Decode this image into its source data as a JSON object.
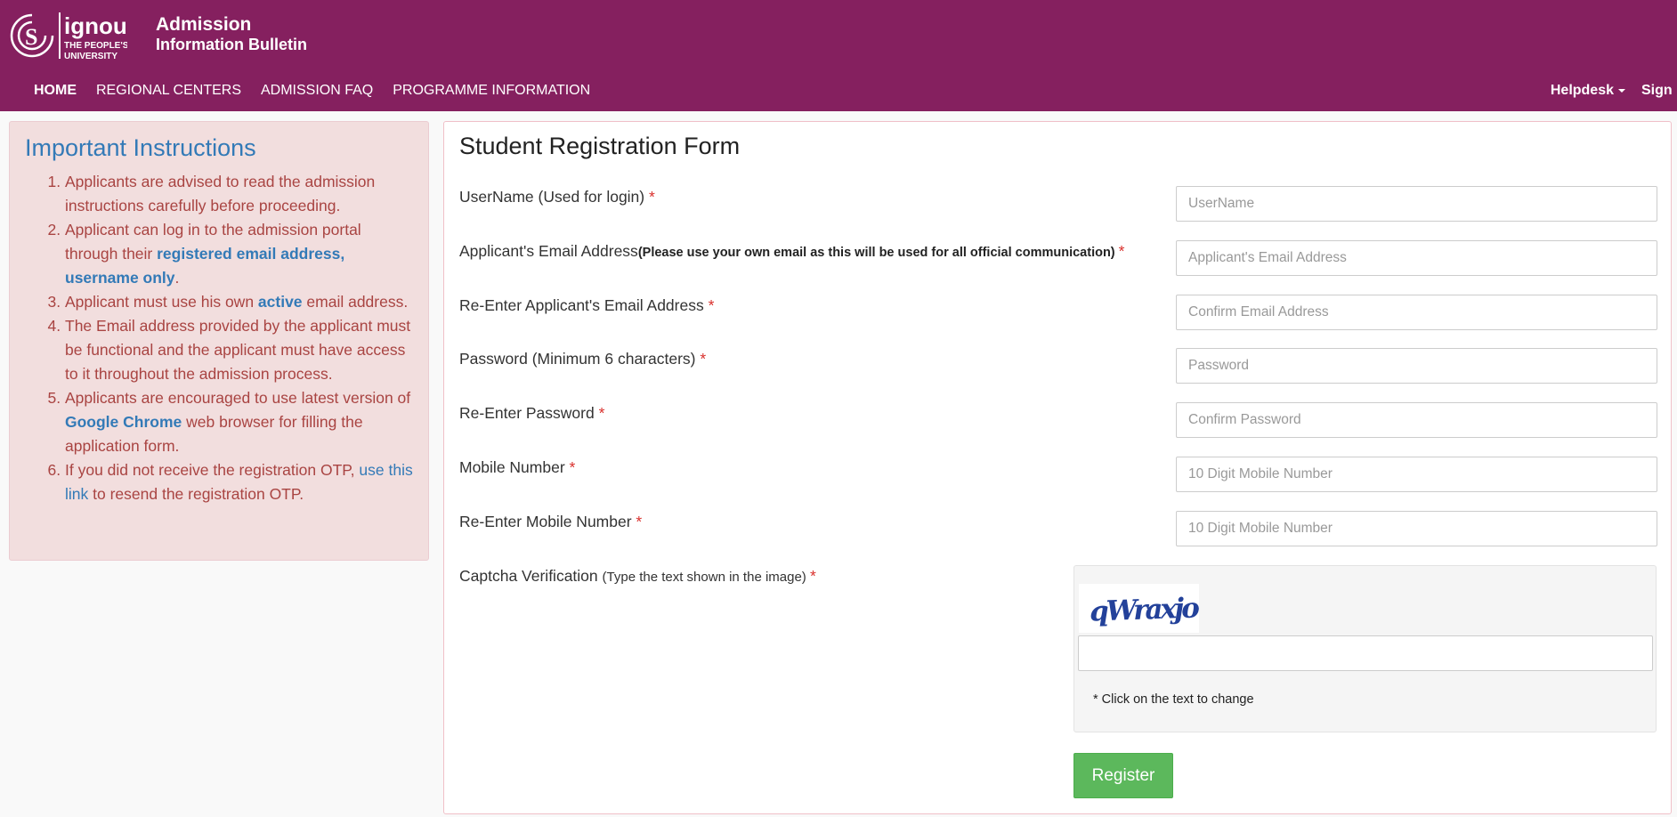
{
  "brand": {
    "logo_name": "ignou",
    "logo_tagline_1": "THE PEOPLE'S",
    "logo_tagline_2": "UNIVERSITY",
    "title_line1": "Admission",
    "title_line2": "Information Bulletin"
  },
  "colors": {
    "header_bg": "#85205f",
    "alert_bg": "#f2dede",
    "alert_text": "#a94442",
    "link": "#337ab7",
    "register_button": "#5cb85c",
    "required": "#d9302c"
  },
  "nav": {
    "left": [
      "HOME",
      "REGIONAL CENTERS",
      "ADMISSION FAQ",
      "PROGRAMME INFORMATION"
    ],
    "helpdesk": "Helpdesk",
    "signin": "Sign In"
  },
  "instructions": {
    "title": "Important Instructions",
    "items": [
      {
        "before": "Applicants are advised to read the admission instructions carefully before proceeding."
      },
      {
        "before": "Applicant can log in to the admission portal through their ",
        "highlight": "registered email address, username only",
        "after": "."
      },
      {
        "before": "Applicant must use his own ",
        "highlight": "active",
        "after": " email address."
      },
      {
        "before": "The Email address provided by the applicant must be functional and the applicant must have access to it throughout the admission process."
      },
      {
        "before": "Applicants are encouraged to use latest version of ",
        "highlight": "Google Chrome",
        "after": " web browser for filling the application form."
      },
      {
        "before": "If you did not receive the registration OTP, ",
        "link": "use this link",
        "after": " to resend the registration OTP."
      }
    ]
  },
  "form": {
    "title": "Student Registration Form",
    "required_mark": "*",
    "fields": [
      {
        "label": "UserName (Used for login) ",
        "placeholder": "UserName"
      },
      {
        "label": "Applicant's Email Address",
        "note": "(Please use your own email as this will be used for all official communication) ",
        "placeholder": "Applicant's Email Address"
      },
      {
        "label": "Re-Enter Applicant's Email Address ",
        "placeholder": "Confirm Email Address"
      },
      {
        "label": "Password (Minimum 6 characters) ",
        "placeholder": "Password"
      },
      {
        "label": "Re-Enter Password ",
        "placeholder": "Confirm Password"
      },
      {
        "label": "Mobile Number ",
        "placeholder": "10 Digit Mobile Number"
      },
      {
        "label": "Re-Enter Mobile Number ",
        "placeholder": "10 Digit Mobile Number"
      }
    ],
    "captcha": {
      "label": "Captcha Verification ",
      "note": "(Type the text shown in the image) ",
      "image_text": "qWraxjo",
      "value": "",
      "help": "* Click on the text to change"
    },
    "register_label": "Register"
  }
}
